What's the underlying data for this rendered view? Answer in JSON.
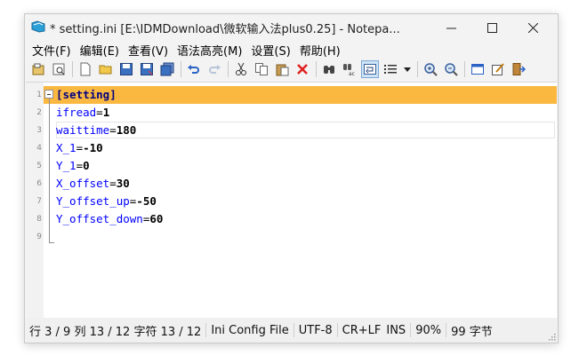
{
  "window": {
    "title": "* setting.ini [E:\\IDMDownload\\微软输入法plus0.25] - Notepa...",
    "controls": [
      "minimize-icon",
      "maximize-icon",
      "close-icon"
    ]
  },
  "menu": [
    "文件(F)",
    "编辑(E)",
    "查看(V)",
    "语法高亮(M)",
    "设置(S)",
    "帮助(H)"
  ],
  "toolbar": [
    "template-icon",
    "open-recent-icon",
    "new-file-icon",
    "open-folder-icon",
    "save-icon",
    "save-as-icon",
    "save-all-icon",
    "undo-icon",
    "redo-icon",
    "cut-icon",
    "copy-icon",
    "paste-icon",
    "delete-icon",
    "find-icon",
    "replace-icon",
    "word-wrap-icon",
    "list-icon",
    "dropdown-icon",
    "zoom-in-icon",
    "zoom-out-icon",
    "view-icon",
    "edit-scheme-icon",
    "exit-icon"
  ],
  "editor": {
    "lines": [
      {
        "num": "1",
        "section": "[setting]"
      },
      {
        "num": "2",
        "key": "ifread",
        "value": "1"
      },
      {
        "num": "3",
        "key": "waittime",
        "value": "180"
      },
      {
        "num": "4",
        "key": "X_1",
        "value": "-10"
      },
      {
        "num": "5",
        "key": "Y_1",
        "value": "0"
      },
      {
        "num": "6",
        "key": "X_offset",
        "value": "30"
      },
      {
        "num": "7",
        "key": "Y_offset_up",
        "value": "-50"
      },
      {
        "num": "8",
        "key": "Y_offset_down",
        "value": "60"
      },
      {
        "num": "9"
      }
    ],
    "colors": {
      "section_highlight": "#fbb841",
      "key": "#0000ff",
      "section_text": "#000080"
    }
  },
  "status": {
    "position": "行 3 / 9  列 13 / 12  字符 13 / 12",
    "syntax": "Ini Config File",
    "encoding": "UTF-8",
    "line_ending": "CR+LF",
    "mode": "INS",
    "zoom": "90%",
    "size": "99 字节"
  }
}
